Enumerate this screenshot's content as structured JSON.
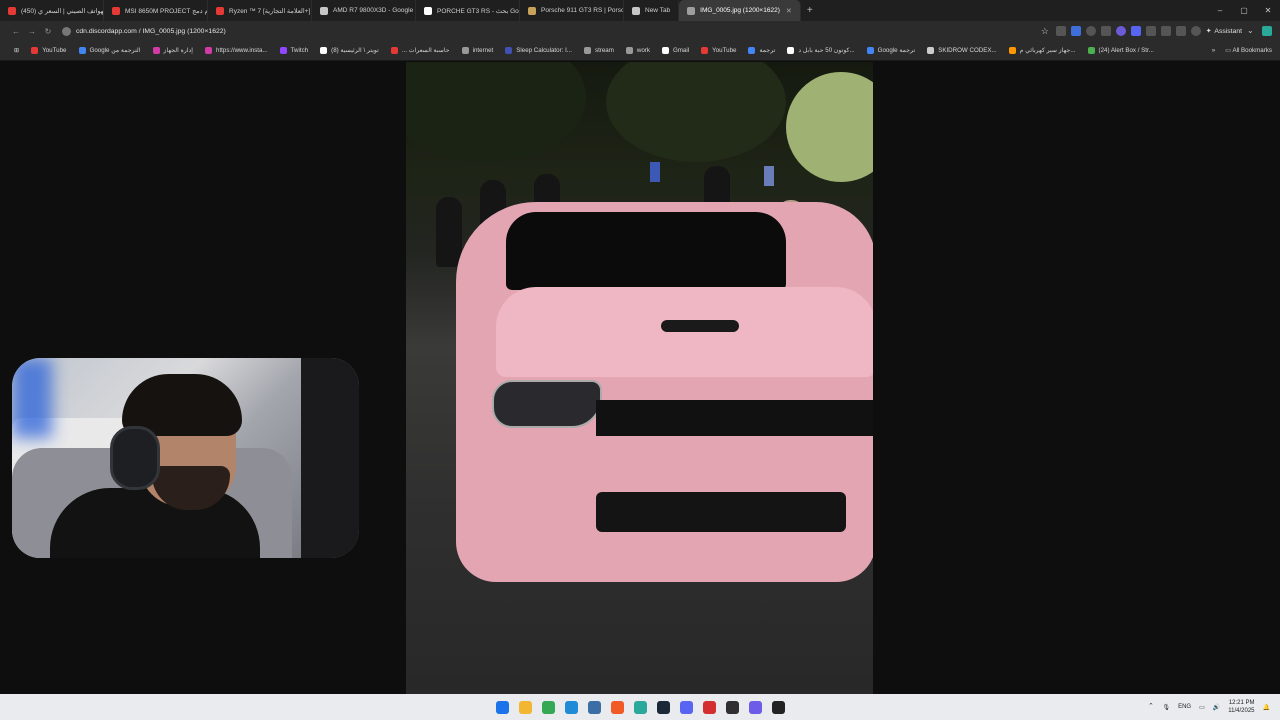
{
  "tabs": [
    {
      "title": "(450) الهواتف الصيني | السعر ي...",
      "color": "#e53935",
      "active": false
    },
    {
      "title": "MSI 8650M PROJECT أكام دمج",
      "color": "#e53935",
      "active": false
    },
    {
      "title": "Ryzen ™ 7 [العلامة التجارية+]",
      "color": "#e53935",
      "active": false
    },
    {
      "title": "AMD R7 9800X3D - Google S...",
      "color": "#c7c7c7",
      "active": false
    },
    {
      "title": "PORCHE GT3 RS - بحث Googl...",
      "color": "#ffffff",
      "active": false
    },
    {
      "title": "Porsche 911 GT3 RS | Porsche",
      "color": "#c8a25b",
      "active": false
    },
    {
      "title": "New Tab",
      "color": "#c7c7c7",
      "active": false
    },
    {
      "title": "IMG_0005.jpg (1200×1622)",
      "color": "#9e9e9e",
      "active": true
    }
  ],
  "new_tab_glyph": "+",
  "window_controls": {
    "minimize": "–",
    "maximize": "▢",
    "close": "✕"
  },
  "address": {
    "url": "cdn.discordapp.com / IMG_0005.jpg (1200×1622)",
    "back": "←",
    "forward": "→",
    "reload": "↻"
  },
  "assistant_label": "Assistant",
  "bookmarks": [
    {
      "label": "YouTube",
      "color": "#e53935"
    },
    {
      "label": "Google الترجمة من",
      "color": "#4285f4"
    },
    {
      "label": "إدارة الجهاز",
      "color": "#d23ba6"
    },
    {
      "label": "https://www.insta...",
      "color": "#d23ba6"
    },
    {
      "label": "Twitch",
      "color": "#9146ff"
    },
    {
      "label": "(8) تويتر \\ الرئيسية",
      "color": "#ffffff"
    },
    {
      "label": "... حاسبة السعرات",
      "color": "#e53935"
    },
    {
      "label": "internet",
      "color": "#999999"
    },
    {
      "label": "Sleep Calculator: I...",
      "color": "#3f51b5"
    },
    {
      "label": "stream",
      "color": "#999999"
    },
    {
      "label": "work",
      "color": "#999999"
    },
    {
      "label": "Gmail",
      "color": "#ffffff"
    },
    {
      "label": "YouTube",
      "color": "#e53935"
    },
    {
      "label": "ترجمة",
      "color": "#4285f4"
    },
    {
      "label": "كوتون 50 حبة بابل د...",
      "color": "#ffffff"
    },
    {
      "label": "Google ترجمة",
      "color": "#4285f4"
    },
    {
      "label": "SKIDROW CODEX...",
      "color": "#cccccc"
    },
    {
      "label": "جهاز سير كهربائي م...",
      "color": "#ff9800"
    },
    {
      "label": "(24) Alert Box / Str...",
      "color": "#4caf50"
    }
  ],
  "bookmarks_more": "»",
  "all_bookmarks_label": "All Bookmarks",
  "taskbar_icons": [
    {
      "name": "windows-start-icon",
      "color": "#1a73e8"
    },
    {
      "name": "file-explorer-icon",
      "color": "#f2b632"
    },
    {
      "name": "chrome-icon",
      "color": "#34a853"
    },
    {
      "name": "edge-icon",
      "color": "#1f8ad6"
    },
    {
      "name": "app-store-icon",
      "color": "#3b6ea5"
    },
    {
      "name": "brave-icon",
      "color": "#f15a24"
    },
    {
      "name": "edge-beta-icon",
      "color": "#2aa89a"
    },
    {
      "name": "steam-icon",
      "color": "#1b2838"
    },
    {
      "name": "discord-icon",
      "color": "#5865f2"
    },
    {
      "name": "app-red-icon",
      "color": "#d32f2f"
    },
    {
      "name": "obs-icon",
      "color": "#302e31"
    },
    {
      "name": "game-icon",
      "color": "#6c5ce7"
    },
    {
      "name": "app-dark-icon",
      "color": "#222222"
    }
  ],
  "tray": {
    "chevron": "⌃",
    "lang": "ENG",
    "time": "12:21 PM",
    "date": "11/4/2025"
  }
}
